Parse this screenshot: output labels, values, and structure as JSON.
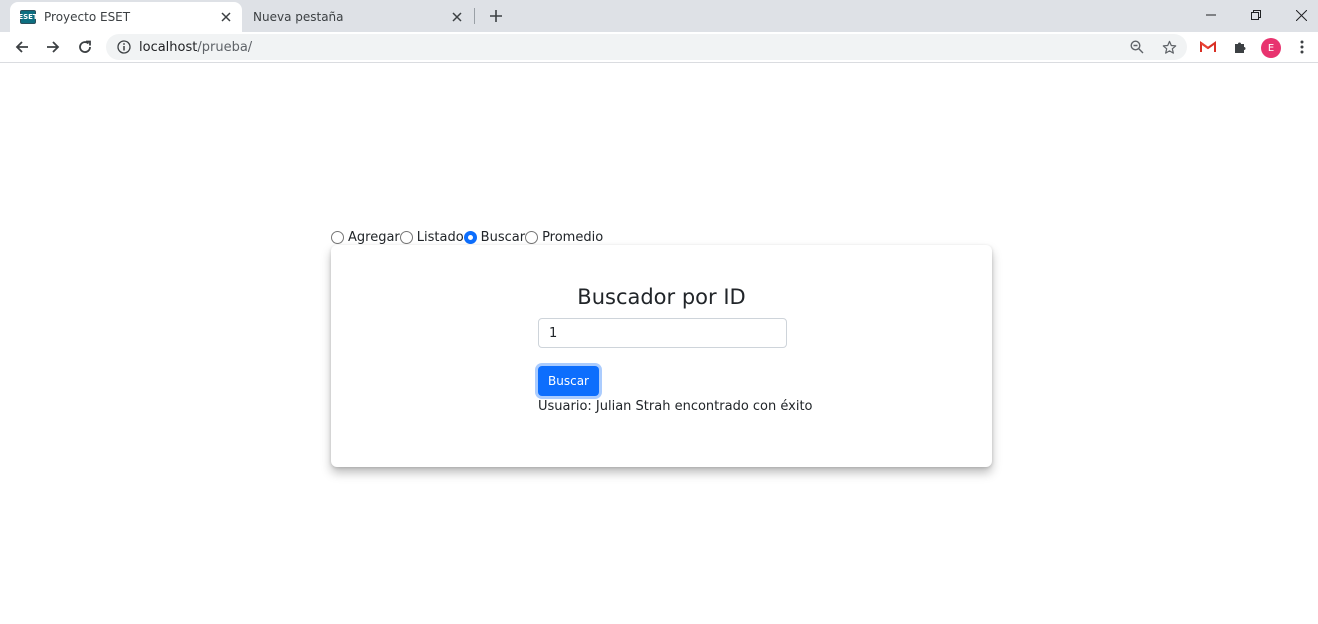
{
  "browser": {
    "tabs": [
      {
        "title": "Proyecto ESET",
        "favicon": "ESET",
        "active": true
      },
      {
        "title": "Nueva pestaña",
        "active": false
      }
    ],
    "url_host": "localhost",
    "url_path": "/prueba/",
    "profile_initial": "E",
    "colors": {
      "tabstrip": "#dee1e6",
      "omnibox": "#f1f3f4",
      "avatar": "#e8336f"
    }
  },
  "page": {
    "radio_options": [
      {
        "label": "Agregar",
        "checked": false
      },
      {
        "label": "Listado",
        "checked": false
      },
      {
        "label": "Buscar",
        "checked": true
      },
      {
        "label": "Promedio",
        "checked": false
      }
    ],
    "card": {
      "heading": "Buscador por ID",
      "input_value": "1",
      "button_label": "Buscar",
      "result_message": "Usuario: Julian Strah encontrado con éxito"
    },
    "colors": {
      "primary": "#0d6efd"
    }
  }
}
